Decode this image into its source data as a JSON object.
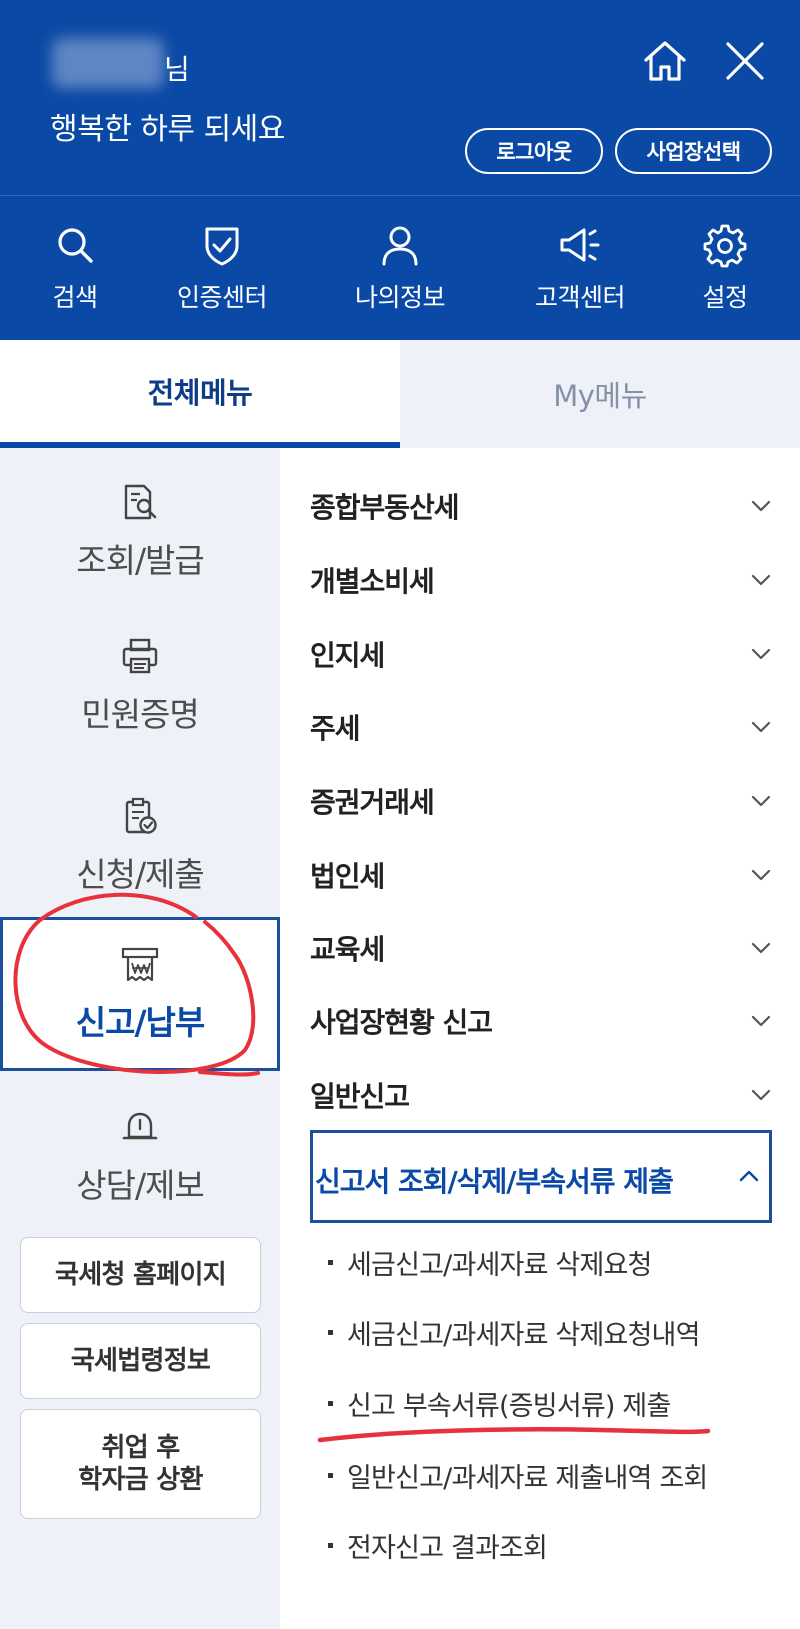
{
  "header": {
    "greeting_suffix": "님",
    "greeting_line": "행복한 하루 되세요",
    "logout_label": "로그아웃",
    "site_select_label": "사업장선택",
    "bg_color": "#0a49a5"
  },
  "quick_nav": [
    {
      "label": "검색",
      "icon": "search-icon"
    },
    {
      "label": "인증센터",
      "icon": "shield-check-icon"
    },
    {
      "label": "나의정보",
      "icon": "user-icon"
    },
    {
      "label": "고객센터",
      "icon": "megaphone-icon"
    },
    {
      "label": "설정",
      "icon": "gear-icon"
    }
  ],
  "tabs": [
    {
      "label": "전체메뉴",
      "active": true
    },
    {
      "label": "My메뉴",
      "active": false
    }
  ],
  "categories": [
    {
      "label": "조회/발급",
      "icon": "document-search-icon",
      "active": false
    },
    {
      "label": "민원증명",
      "icon": "printer-icon",
      "active": false
    },
    {
      "label": "신청/제출",
      "icon": "clipboard-check-icon",
      "active": false
    },
    {
      "label": "신고/납부",
      "icon": "receipt-won-icon",
      "active": true
    },
    {
      "label": "상담/제보",
      "icon": "bell-icon",
      "active": false
    }
  ],
  "side_buttons": [
    "국세청 홈페이지",
    "국세법령정보",
    "취업 후\n학자금 상환"
  ],
  "menu": [
    {
      "label": "종합부동산세"
    },
    {
      "label": "개별소비세"
    },
    {
      "label": "인지세"
    },
    {
      "label": "주세"
    },
    {
      "label": "증권거래세"
    },
    {
      "label": "법인세"
    },
    {
      "label": "교육세"
    },
    {
      "label": "사업장현황 신고"
    },
    {
      "label": "일반신고"
    }
  ],
  "menu_open": {
    "label": "신고서 조회/삭제/부속서류 제출",
    "sub_items": [
      "세금신고/과세자료 삭제요청",
      "세금신고/과세자료 삭제요청내역",
      "신고 부속서류(증빙서류) 제출",
      "일반신고/과세자료 제출내역 조회",
      "전자신고 결과조회"
    ]
  },
  "colors": {
    "accent": "#0a49a5",
    "annotation_red": "#e8323b",
    "panel_bg": "#eef1f7"
  }
}
